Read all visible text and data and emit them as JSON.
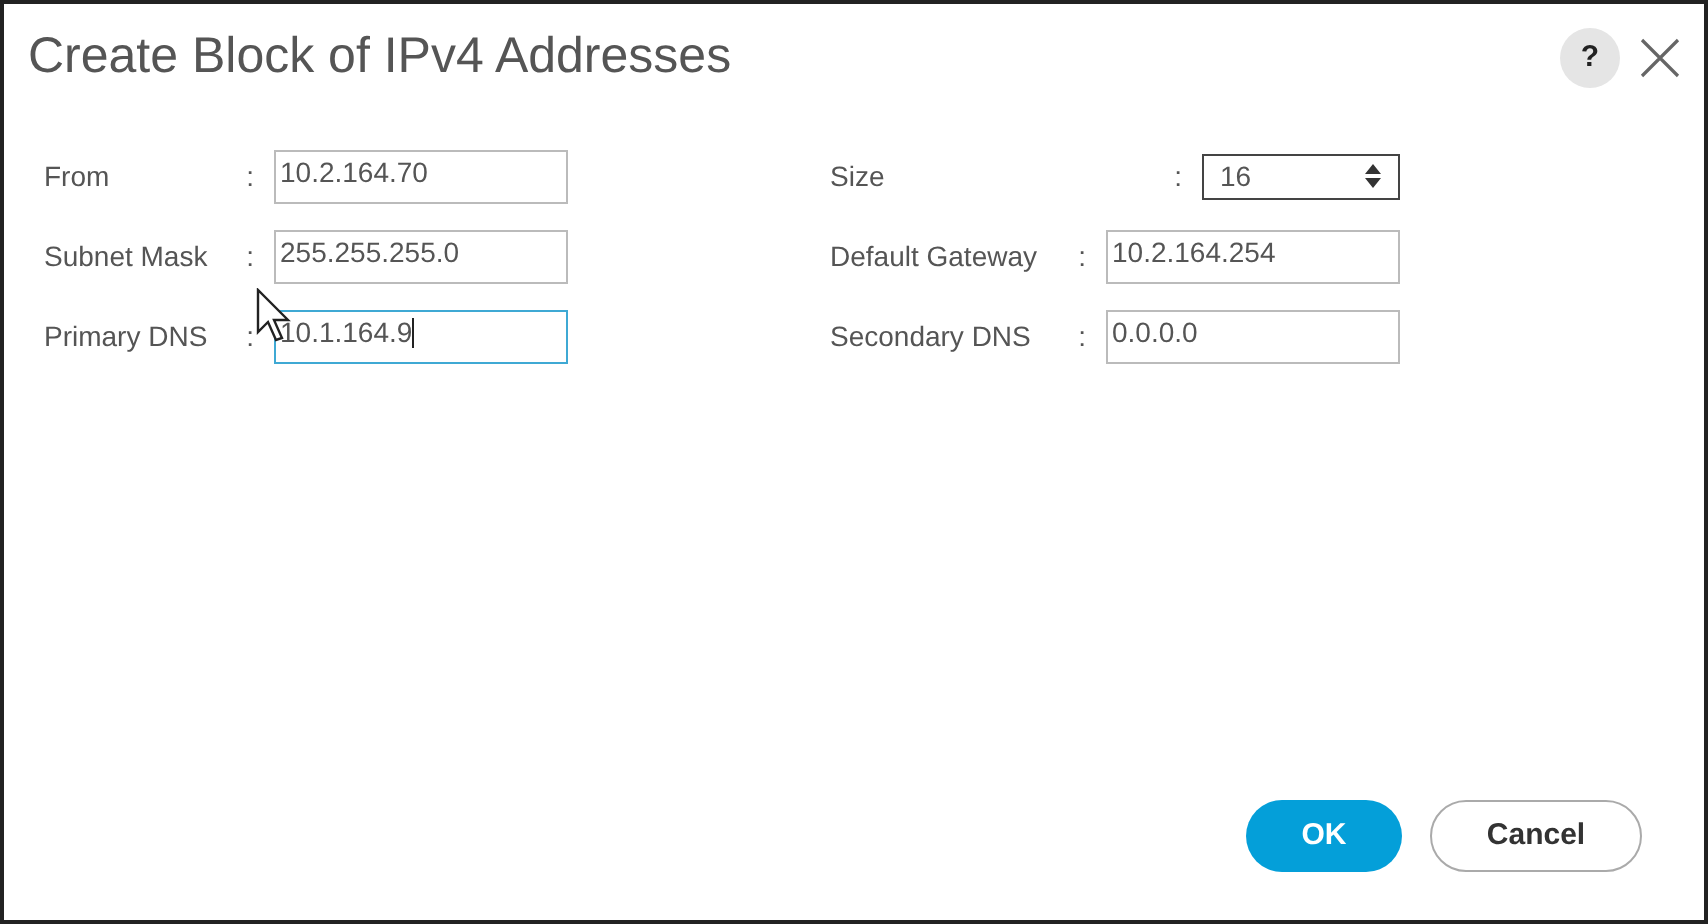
{
  "dialog": {
    "title": "Create Block of IPv4 Addresses",
    "help": "?"
  },
  "columns": [
    {
      "fields": [
        {
          "kind": "text",
          "label": "From",
          "colon": ":",
          "value": "10.2.164.70",
          "focused": false
        },
        {
          "kind": "text",
          "label": "Subnet Mask",
          "colon": ":",
          "value": "255.255.255.0",
          "focused": false
        },
        {
          "kind": "text",
          "label": "Primary DNS",
          "colon": ":",
          "value": "10.1.164.9",
          "focused": true
        }
      ]
    },
    {
      "fields": [
        {
          "kind": "spinner",
          "label": "Size",
          "colon": ":",
          "value": "16",
          "focused": false
        },
        {
          "kind": "text",
          "label": "Default Gateway",
          "colon": ":",
          "value": "10.2.164.254",
          "focused": false
        },
        {
          "kind": "text",
          "label": "Secondary DNS",
          "colon": ":",
          "value": "0.0.0.0",
          "focused": false
        }
      ]
    }
  ],
  "buttons": [
    {
      "kind": "primary",
      "label": "OK"
    },
    {
      "kind": "secondary",
      "label": "Cancel"
    }
  ]
}
